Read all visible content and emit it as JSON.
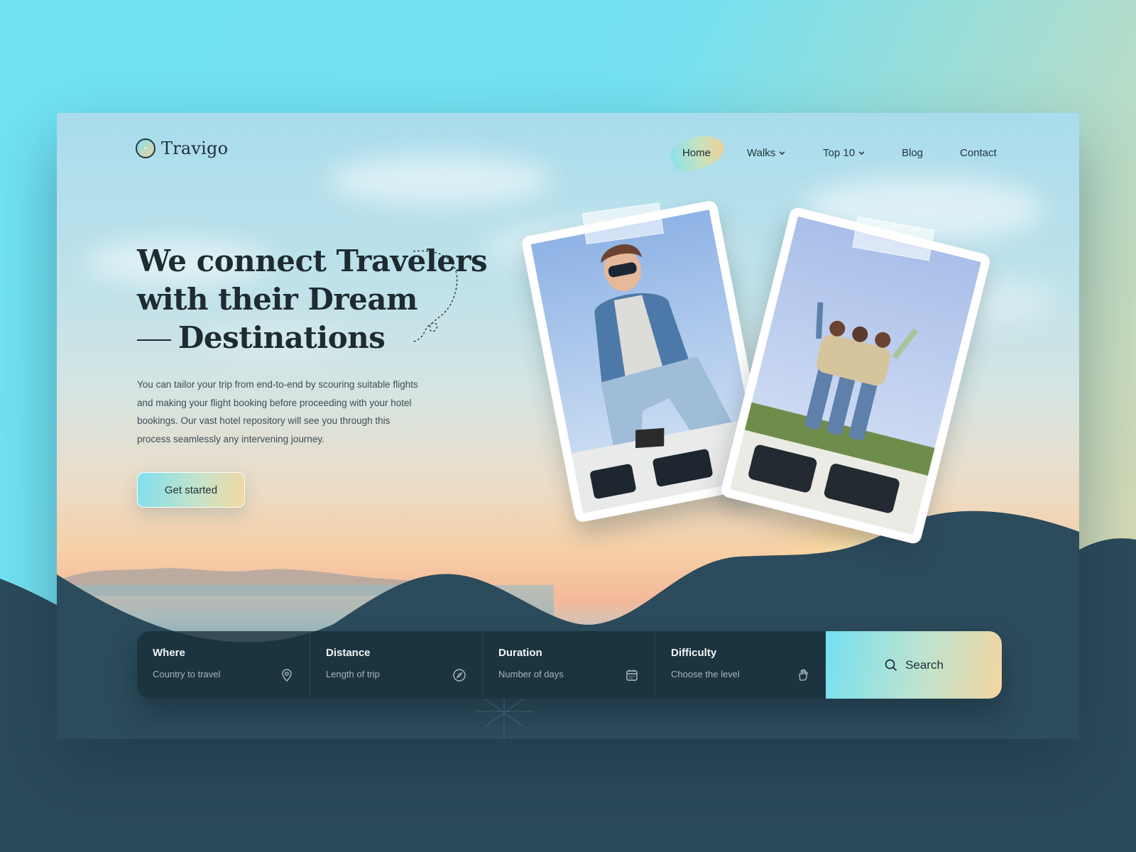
{
  "brand": {
    "name": "Travigo",
    "logo_icon": "compass-icon"
  },
  "nav": {
    "items": [
      {
        "label": "Home",
        "active": true
      },
      {
        "label": "Walks",
        "dropdown": true
      },
      {
        "label": "Top 10",
        "dropdown": true
      },
      {
        "label": "Blog"
      },
      {
        "label": "Contact"
      }
    ]
  },
  "hero": {
    "headline": {
      "l1_normal": "We connect ",
      "l1_bold": "Travelers",
      "l2_normal": "with their ",
      "l2_bold": "Dream",
      "l3_bold": "Destinations"
    },
    "description": "You can tailor your trip from end-to-end by scouring suitable flights and making your flight booking before proceeding with your hotel bookings. Our vast hotel repository will see you through this process seamlessly any intervening journey.",
    "cta_label": "Get started"
  },
  "search": {
    "fields": [
      {
        "label": "Where",
        "placeholder": "Country to travel",
        "icon": "location-pin-icon"
      },
      {
        "label": "Distance",
        "placeholder": "Length of trip",
        "icon": "compass-icon"
      },
      {
        "label": "Duration",
        "placeholder": "Number of days",
        "icon": "calendar-icon"
      },
      {
        "label": "Difficulty",
        "placeholder": "Choose the level",
        "icon": "hand-icon"
      }
    ],
    "button_label": "Search",
    "button_icon": "search-icon"
  },
  "colors": {
    "accent_start": "#75e0f0",
    "accent_end": "#f3d6a0",
    "dark_wave": "#2c4b5c",
    "text_dark": "#1e2b31"
  }
}
